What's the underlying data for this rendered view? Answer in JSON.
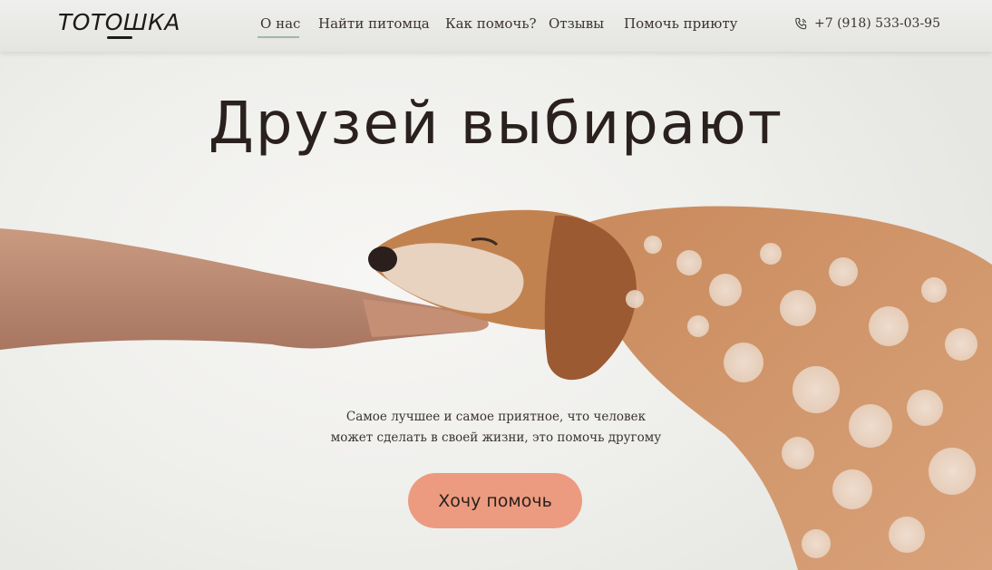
{
  "header": {
    "logo": "ТОТОШКА",
    "nav": [
      "О нас",
      "Найти питомца",
      "Как помочь?",
      "Отзывы",
      "Помочь приюту"
    ],
    "active_nav": "О нас",
    "phone": "+7 (918) 533-03-95"
  },
  "hero": {
    "title": "Друзей выбирают",
    "subtitle_line1": "Самое лучшее и самое приятное, что человек",
    "subtitle_line2": "может сделать в своей жизни, это помочь другому",
    "cta_label": "Хочу помочь"
  },
  "colors": {
    "accent": "#ec9b80",
    "nav_underline": "#9fb7ac",
    "text": "#2a211e"
  },
  "icons": [
    "phone-icon"
  ]
}
